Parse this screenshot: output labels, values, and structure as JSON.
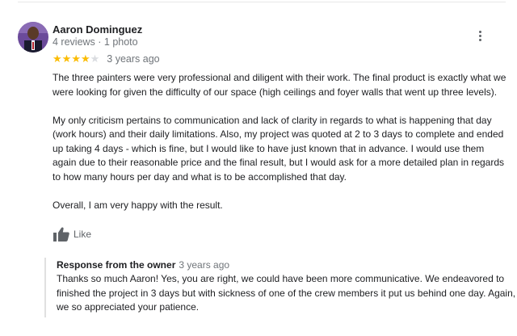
{
  "reviewer": {
    "name": "Aaron Dominguez",
    "meta": "4 reviews · 1 photo"
  },
  "rating": {
    "stars": 4,
    "max": 5,
    "time_ago": "3 years ago"
  },
  "review": {
    "paragraphs": [
      "The three painters were very professional and diligent with their work. The final product is exactly what we were looking for given the difficulty of our space (high ceilings and foyer walls that went up three levels).",
      "My only criticism pertains to communication and lack of clarity in regards to what is happening that day (work hours) and their daily limitations. Also, my project was quoted at 2 to 3 days to complete and ended up taking 4 days - which is fine, but I would like to have just known that in advance. I would use them again due to their reasonable price and the final result, but I would ask for a more detailed plan in regards to how many hours per day and what is to be accomplished that day.",
      "Overall, I am very happy with the result."
    ]
  },
  "actions": {
    "like_label": "Like",
    "like_icon": "thumbs-up-icon",
    "more_icon": "more-vertical-icon"
  },
  "owner_response": {
    "title": "Response from the owner",
    "time_ago": "3 years ago",
    "text": "Thanks so much Aaron! Yes, you are right, we could have been more communicative. We endeavored to finished the project in 3 days but with sickness of one of the crew members it put us behind one day. Again, we so appreciated your patience."
  },
  "colors": {
    "star_filled": "#fbbc04",
    "star_empty": "#dadce0",
    "secondary_text": "#70757a"
  }
}
